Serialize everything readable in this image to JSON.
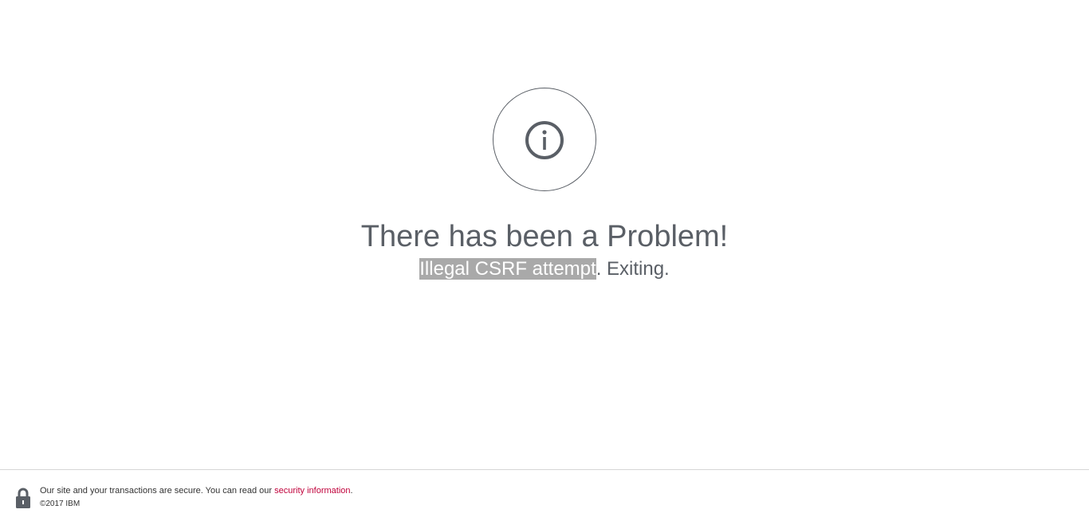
{
  "error": {
    "icon": "info-icon",
    "title": "There has been a Problem!",
    "message_highlighted": "Illegal CSRF attempt",
    "message_rest": ". Exiting."
  },
  "footer": {
    "lock_icon": "lock-icon",
    "secure_text_before": "Our site and your transactions are secure. You can read our ",
    "security_link": "security information",
    "secure_text_after": ".",
    "copyright": "©2017 IBM"
  },
  "colors": {
    "text_gray": "#5a5f66",
    "link_red": "#c0003a",
    "selection_gray": "#a9a9a9"
  }
}
